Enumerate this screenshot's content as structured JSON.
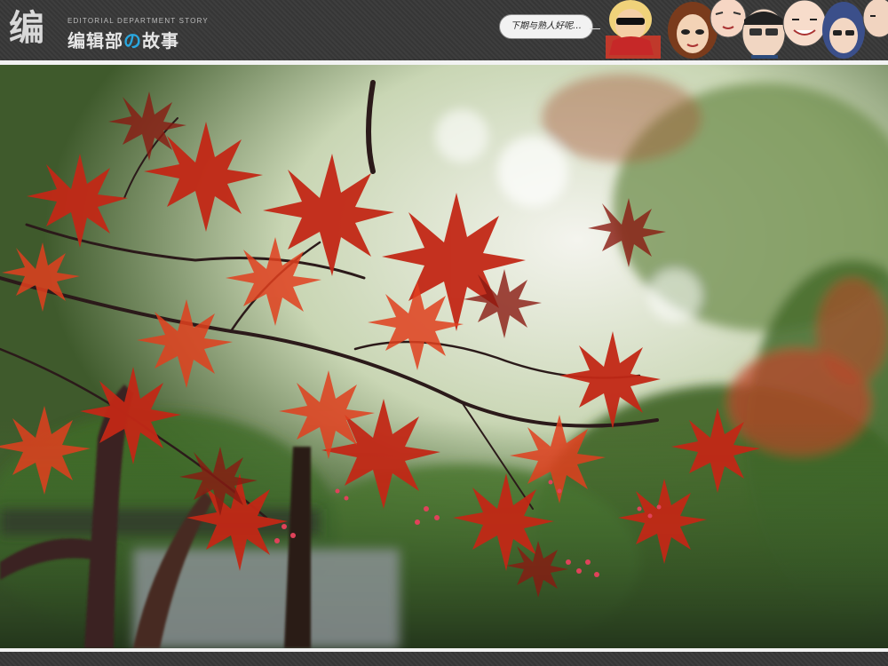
{
  "header": {
    "logo_mark": "编",
    "subtitle": "EDITORIAL DEPARTMENT STORY",
    "title_pre": "编辑部",
    "title_accent": "の",
    "title_post": "故事",
    "bubble_text": "下期与熟人好呢…"
  },
  "colors": {
    "header_bg": "#3a3a3a",
    "accent": "#29a7df",
    "frame": "#f2f2f2"
  },
  "photo": {
    "subject": "red-japanese-maple-leaves"
  }
}
